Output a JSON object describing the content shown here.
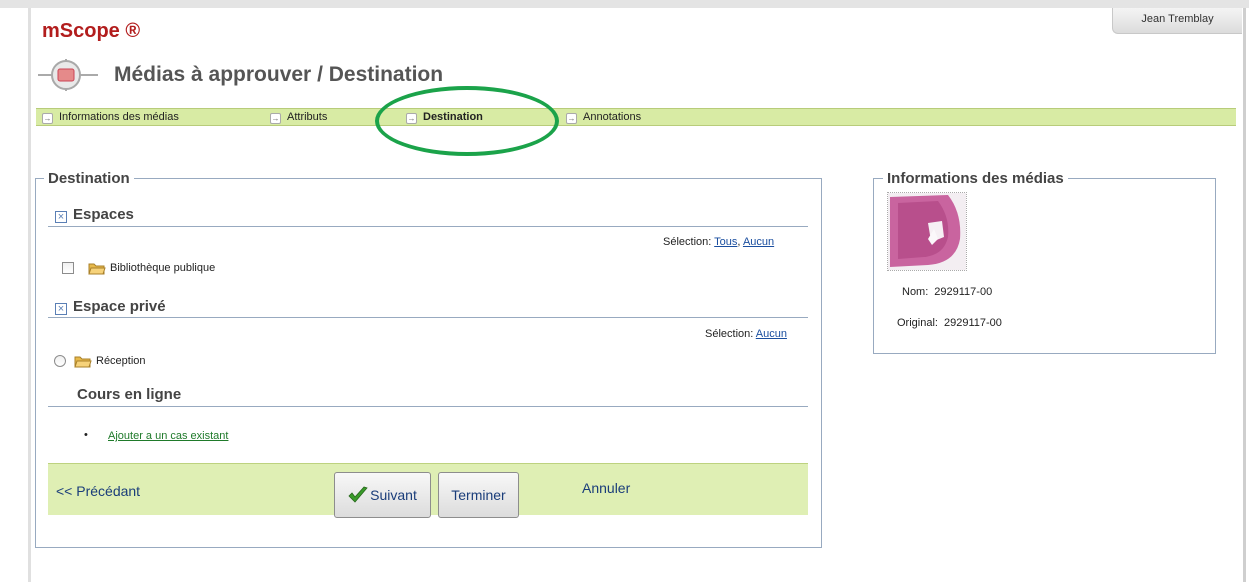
{
  "user": {
    "name": "Jean Tremblay"
  },
  "app": {
    "logo": "mScope ®"
  },
  "page": {
    "title": "Médias à approuver / Destination"
  },
  "tabs": [
    {
      "label": "Informations des médias"
    },
    {
      "label": "Attributs"
    },
    {
      "label": "Destination",
      "active": true
    },
    {
      "label": "Annotations"
    }
  ],
  "destination": {
    "legend": "Destination",
    "espaces": {
      "title": "Espaces",
      "selection_label": "Sélection:",
      "all_link": "Tous",
      "separator": ",",
      "none_link": "Aucun",
      "items": [
        {
          "label": "Bibliothèque publique",
          "checked": false
        }
      ]
    },
    "prive": {
      "title": "Espace privé",
      "selection_label": "Sélection:",
      "none_link": "Aucun",
      "items": [
        {
          "label": "Réception",
          "selected": false
        }
      ]
    },
    "cours": {
      "title": "Cours en ligne",
      "link": "Ajouter a un cas existant"
    }
  },
  "actions": {
    "previous": "<< Précédant",
    "next": "Suivant",
    "finish": "Terminer",
    "cancel": "Annuler"
  },
  "media_info": {
    "legend": "Informations des médias",
    "name_label": "Nom:",
    "name_value": "2929117-00",
    "original_label": "Original:",
    "original_value": "2929117-00"
  },
  "colors": {
    "accent_green": "#d8eba4",
    "annotation_circle": "#1ba34a",
    "logo_red": "#b21d1d",
    "link_blue": "#1a4e9f"
  }
}
